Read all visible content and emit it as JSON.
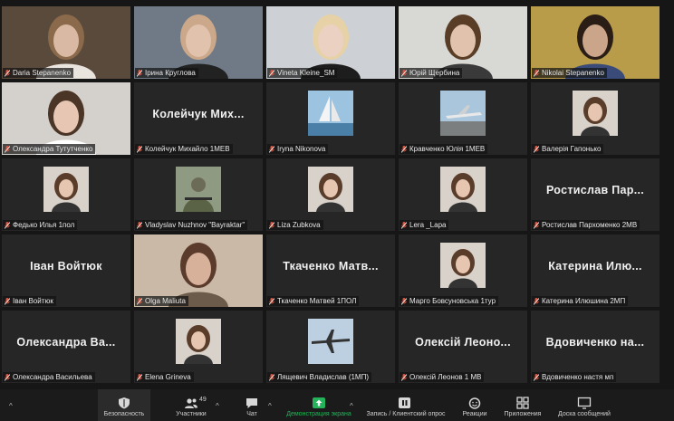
{
  "participants": [
    {
      "name": "Daria Stepanenko",
      "type": "video"
    },
    {
      "name": "Ірина Круглова",
      "type": "video"
    },
    {
      "name": "Vineta Kleine_SM",
      "type": "video",
      "active": true
    },
    {
      "name": "Юрій Щербина",
      "type": "video"
    },
    {
      "name": "Nikolai Stepanenko",
      "type": "video"
    },
    {
      "name": "Олександра Тутутченко",
      "type": "video"
    },
    {
      "name": "Колейчук Михайло 1МЕВ",
      "display": "Колейчук Мих...",
      "type": "text"
    },
    {
      "name": "Iryna Nikonova",
      "type": "thumb",
      "thumb": "sailboat"
    },
    {
      "name": "Кравченко Юлія 1МЕВ",
      "type": "thumb",
      "thumb": "airplane"
    },
    {
      "name": "Валерія Гапонько",
      "type": "thumb",
      "thumb": "portrait"
    },
    {
      "name": "Федько Илья 1пол",
      "type": "thumb",
      "thumb": "portrait"
    },
    {
      "name": "Vladyslav Nuzhnov \"Bayraktar\"",
      "type": "thumb",
      "thumb": "soldier"
    },
    {
      "name": "Liza Zubkova",
      "type": "thumb",
      "thumb": "portrait"
    },
    {
      "name": "Lera _Lapa",
      "type": "thumb",
      "thumb": "portrait"
    },
    {
      "name": "Ростислав Пархоменко 2МВ",
      "display": "Ростислав Пар...",
      "type": "text"
    },
    {
      "name": "Іван Войтюк",
      "display": "Іван Войтюк",
      "type": "text"
    },
    {
      "name": "Olga Maliuta",
      "type": "video"
    },
    {
      "name": "Ткаченко Матвей 1ПОЛ",
      "display": "Ткаченко Матв...",
      "type": "text"
    },
    {
      "name": "Марго Бовсуновська 1тур",
      "type": "thumb",
      "thumb": "portrait"
    },
    {
      "name": "Катерина Илюшина 2МП",
      "display": "Катерина Илю...",
      "type": "text"
    },
    {
      "name": "Олександра Васильева",
      "display": "Олександра Ва...",
      "type": "text"
    },
    {
      "name": "Elena Grineva",
      "type": "thumb",
      "thumb": "portrait"
    },
    {
      "name": "Лящевич Владислав (1МП)",
      "type": "thumb",
      "thumb": "drone"
    },
    {
      "name": "Олексій Леонов 1 МВ",
      "display": "Олексій Леоно...",
      "type": "text"
    },
    {
      "name": "Вдовиченко настя мп",
      "display": "Вдовиченко на...",
      "type": "text"
    }
  ],
  "toolbar": {
    "security_label": "Безопасность",
    "participants_label": "Участники",
    "participants_count": "49",
    "chat_label": "Чат",
    "share_label": "Демонстрация экрана",
    "record_label": "Запись / Клиентский опрос",
    "reactions_label": "Реакции",
    "apps_label": "Приложения",
    "whiteboard_label": "Доска сообщений"
  },
  "colors": {
    "background": "#161616",
    "tile": "#262626",
    "active_speaker": "#c8e04a",
    "muted_mic": "#e0533f",
    "share_green": "#24b35a"
  }
}
